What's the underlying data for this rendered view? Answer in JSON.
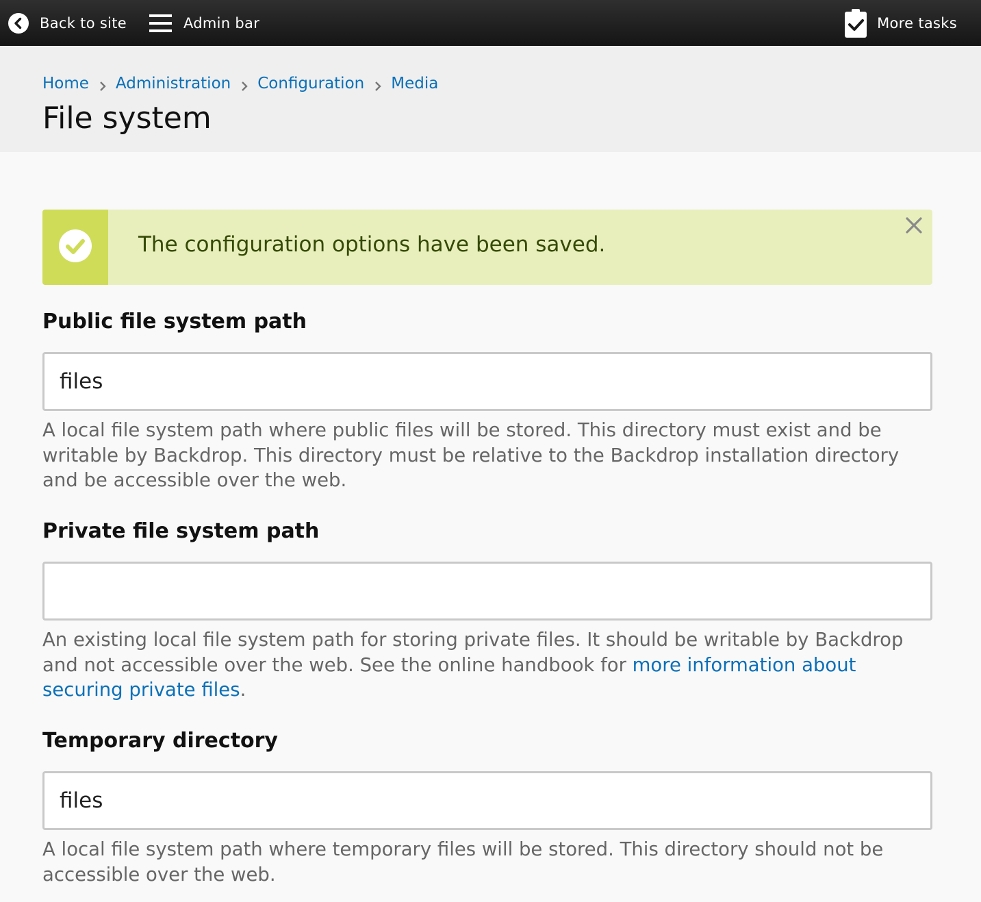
{
  "admin_bar": {
    "back_label": "Back to site",
    "menu_label": "Admin bar",
    "tasks_label": "More tasks"
  },
  "breadcrumb": [
    "Home",
    "Administration",
    "Configuration",
    "Media"
  ],
  "page_title": "File system",
  "message": {
    "text": "The configuration options have been saved.",
    "type": "status"
  },
  "fields": {
    "public": {
      "label": "Public file system path",
      "value": "files",
      "description": "A local file system path where public files will be stored. This directory must exist and be writable by Backdrop. This directory must be relative to the Backdrop installation directory and be accessible over the web."
    },
    "private": {
      "label": "Private file system path",
      "value": "",
      "description_before": "An existing local file system path for storing private files. It should be writable by Backdrop and not accessible over the web. See the online handbook for ",
      "description_link": "more information about securing private files",
      "description_after": "."
    },
    "temporary": {
      "label": "Temporary directory",
      "value": "files",
      "description": "A local file system path where temporary files will be stored. This directory should not be accessible over the web."
    }
  },
  "colors": {
    "link": "#0b70b8",
    "status_bg": "#e9efbc",
    "status_accent": "#cfdc58",
    "status_text": "#344a06",
    "admin_bar": "#1f1f1f"
  },
  "icons": {
    "back": "circle-chevron-left-icon",
    "menu": "hamburger-icon",
    "tasks": "clipboard-check-icon",
    "breadcrumb_separator": "chevron-right-icon",
    "message": "check-circle-icon",
    "close": "close-icon"
  }
}
